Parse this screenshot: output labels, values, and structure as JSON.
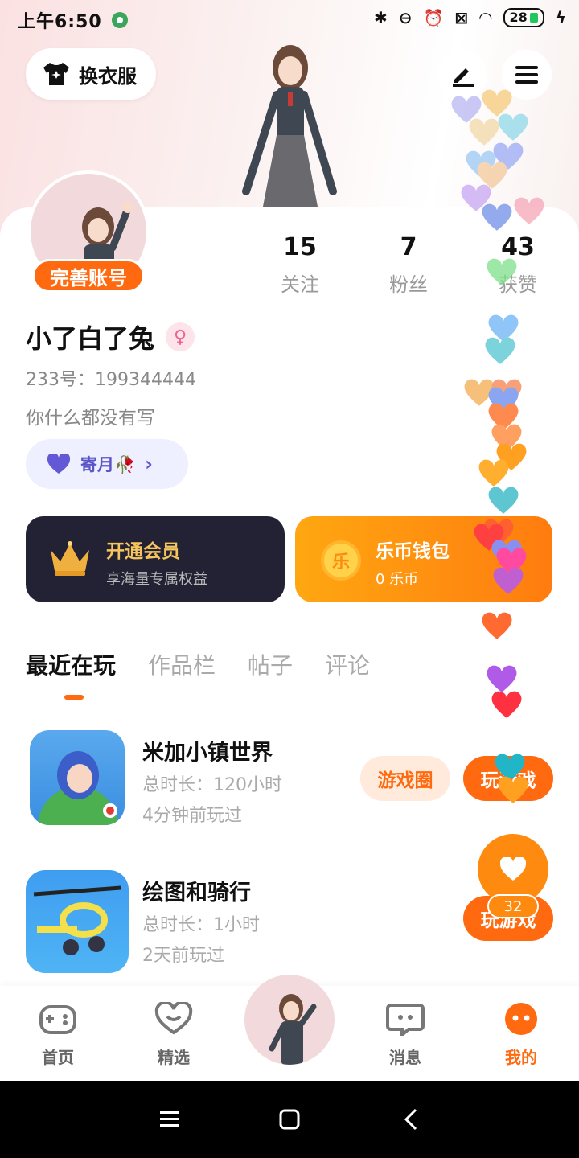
{
  "status_bar": {
    "time": "上午6:50",
    "battery": "28"
  },
  "header": {
    "outfit_button": "换衣服",
    "edit_icon": "pen-icon",
    "menu_icon": "menu-icon"
  },
  "profile": {
    "complete_button": "完善账号",
    "stats": [
      {
        "value": "15",
        "label": "关注"
      },
      {
        "value": "7",
        "label": "粉丝"
      },
      {
        "value": "43",
        "label": "获赞"
      }
    ],
    "username": "小了白了兔",
    "gender_symbol": "♀",
    "uid": "233号：199344444",
    "bio": "你什么都没有写",
    "tag": "寄月🥀"
  },
  "cards": {
    "vip": {
      "title": "开通会员",
      "subtitle": "享海量专属权益"
    },
    "wallet": {
      "title": "乐币钱包",
      "subtitle": "0 乐币",
      "coin_glyph": "乐"
    }
  },
  "tabs": [
    "最近在玩",
    "作品栏",
    "帖子",
    "评论"
  ],
  "games": [
    {
      "title": "米加小镇世界",
      "duration": "总时长：120小时",
      "last_played": "4分钟前玩过",
      "circle_button": "游戏圈",
      "play_button": "玩游戏"
    },
    {
      "title": "绘图和骑行",
      "duration": "总时长：1小时",
      "last_played": "2天前玩过",
      "play_button": "玩游戏"
    }
  ],
  "like_fab": {
    "count": "32"
  },
  "bottom_nav": [
    {
      "label": "首页"
    },
    {
      "label": "精选"
    },
    {
      "label": "消息"
    },
    {
      "label": "我的"
    }
  ],
  "colors": {
    "accent": "#ff6a10",
    "vip_gold": "#f6c55d",
    "vip_bg": "#232234",
    "wallet_start": "#ffa711",
    "wallet_end": "#ff7c0f"
  }
}
